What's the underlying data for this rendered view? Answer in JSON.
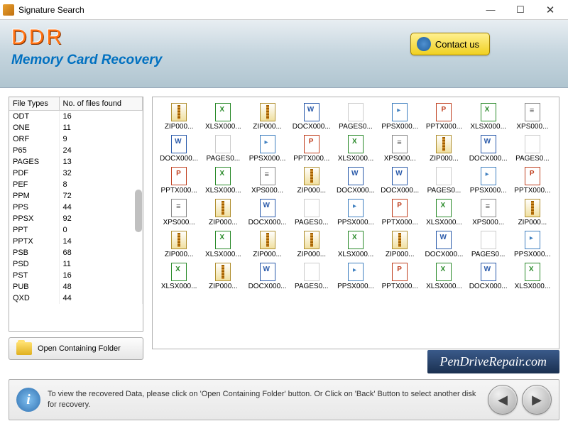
{
  "window": {
    "title": "Signature Search"
  },
  "header": {
    "logo": "DDR",
    "subtitle": "Memory Card Recovery",
    "contact_label": "Contact us"
  },
  "file_types_table": {
    "col_type": "File Types",
    "col_count": "No. of files found",
    "rows": [
      {
        "type": "ODT",
        "count": 16
      },
      {
        "type": "ONE",
        "count": 11
      },
      {
        "type": "ORF",
        "count": 9
      },
      {
        "type": "P65",
        "count": 24
      },
      {
        "type": "PAGES",
        "count": 13
      },
      {
        "type": "PDF",
        "count": 32
      },
      {
        "type": "PEF",
        "count": 8
      },
      {
        "type": "PPM",
        "count": 72
      },
      {
        "type": "PPS",
        "count": 44
      },
      {
        "type": "PPSX",
        "count": 92
      },
      {
        "type": "PPT",
        "count": 0
      },
      {
        "type": "PPTX",
        "count": 14
      },
      {
        "type": "PSB",
        "count": 68
      },
      {
        "type": "PSD",
        "count": 11
      },
      {
        "type": "PST",
        "count": 16
      },
      {
        "type": "PUB",
        "count": 48
      },
      {
        "type": "QXD",
        "count": 44
      }
    ]
  },
  "open_folder_label": "Open Containing Folder",
  "files": [
    {
      "t": "zip",
      "n": "ZIP000..."
    },
    {
      "t": "xlsx",
      "n": "XLSX000..."
    },
    {
      "t": "zip",
      "n": "ZIP000..."
    },
    {
      "t": "docx",
      "n": "DOCX000..."
    },
    {
      "t": "pages",
      "n": "PAGES0..."
    },
    {
      "t": "ppsx",
      "n": "PPSX000..."
    },
    {
      "t": "pptx",
      "n": "PPTX000..."
    },
    {
      "t": "xlsx",
      "n": "XLSX000..."
    },
    {
      "t": "xps",
      "n": "XPS000..."
    },
    {
      "t": "docx",
      "n": "DOCX000..."
    },
    {
      "t": "pages",
      "n": "PAGES0..."
    },
    {
      "t": "ppsx",
      "n": "PPSX000..."
    },
    {
      "t": "pptx",
      "n": "PPTX000..."
    },
    {
      "t": "xlsx",
      "n": "XLSX000..."
    },
    {
      "t": "xps",
      "n": "XPS000..."
    },
    {
      "t": "zip",
      "n": "ZIP000..."
    },
    {
      "t": "docx",
      "n": "DOCX000..."
    },
    {
      "t": "pages",
      "n": "PAGES0..."
    },
    {
      "t": "pptx",
      "n": "PPTX000..."
    },
    {
      "t": "xlsx",
      "n": "XLSX000..."
    },
    {
      "t": "xps",
      "n": "XPS000..."
    },
    {
      "t": "zip",
      "n": "ZIP000..."
    },
    {
      "t": "docx",
      "n": "DOCX000..."
    },
    {
      "t": "docx",
      "n": "DOCX000..."
    },
    {
      "t": "pages",
      "n": "PAGES0..."
    },
    {
      "t": "ppsx",
      "n": "PPSX000..."
    },
    {
      "t": "pptx",
      "n": "PPTX000..."
    },
    {
      "t": "xps",
      "n": "XPS000..."
    },
    {
      "t": "zip",
      "n": "ZIP000..."
    },
    {
      "t": "docx",
      "n": "DOCX000..."
    },
    {
      "t": "pages",
      "n": "PAGES0..."
    },
    {
      "t": "ppsx",
      "n": "PPSX000..."
    },
    {
      "t": "pptx",
      "n": "PPTX000..."
    },
    {
      "t": "xlsx",
      "n": "XLSX000..."
    },
    {
      "t": "xps",
      "n": "XPS000..."
    },
    {
      "t": "zip",
      "n": "ZIP000..."
    },
    {
      "t": "zip",
      "n": "ZIP000..."
    },
    {
      "t": "xlsx",
      "n": "XLSX000..."
    },
    {
      "t": "zip",
      "n": "ZIP000..."
    },
    {
      "t": "zip",
      "n": "ZIP000..."
    },
    {
      "t": "xlsx",
      "n": "XLSX000..."
    },
    {
      "t": "zip",
      "n": "ZIP000..."
    },
    {
      "t": "docx",
      "n": "DOCX000..."
    },
    {
      "t": "pages",
      "n": "PAGES0..."
    },
    {
      "t": "ppsx",
      "n": "PPSX000..."
    },
    {
      "t": "xlsx",
      "n": "XLSX000..."
    },
    {
      "t": "zip",
      "n": "ZIP000..."
    },
    {
      "t": "docx",
      "n": "DOCX000..."
    },
    {
      "t": "pages",
      "n": "PAGES0..."
    },
    {
      "t": "ppsx",
      "n": "PPSX000..."
    },
    {
      "t": "pptx",
      "n": "PPTX000..."
    },
    {
      "t": "xlsx",
      "n": "XLSX000..."
    },
    {
      "t": "docx",
      "n": "DOCX000..."
    },
    {
      "t": "xlsx",
      "n": "XLSX000..."
    }
  ],
  "brand": "PenDriveRepair.com",
  "footer": {
    "info": "To view the recovered Data, please click on 'Open Containing Folder' button. Or Click on 'Back' Button to select another disk for recovery."
  }
}
